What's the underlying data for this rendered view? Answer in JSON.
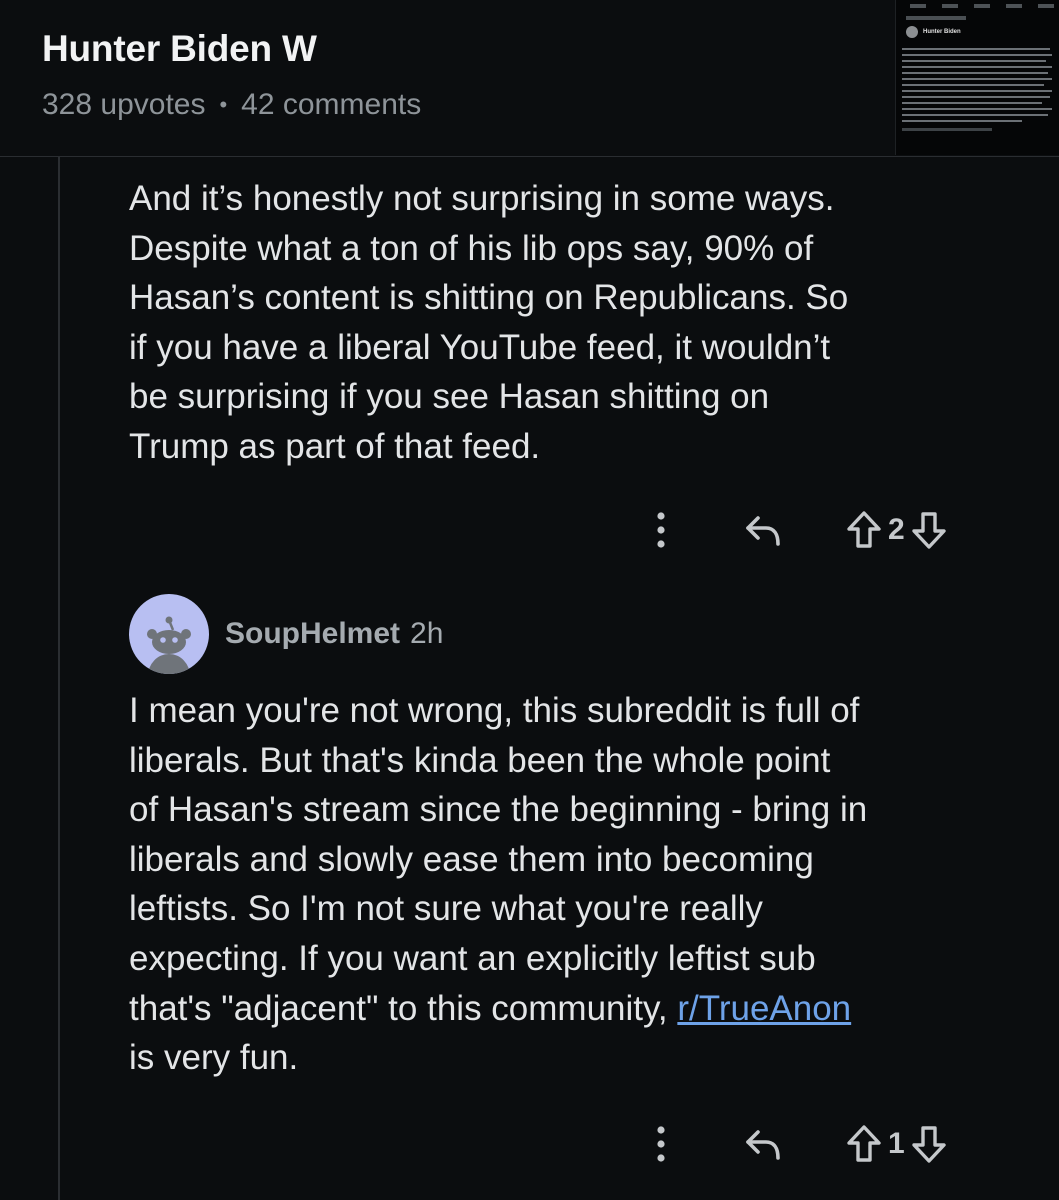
{
  "post": {
    "title": "Hunter Biden W",
    "upvotes": "328 upvotes",
    "separator": "•",
    "comments": "42 comments",
    "thumbnail": {
      "author": "Hunter Biden"
    }
  },
  "comments": [
    {
      "lines": [
        "And it’s honestly not surprising in some ways.",
        "Despite what a ton of his lib ops say, 90% of",
        "Hasan’s content is shitting on Republicans. So",
        "if you have a liberal YouTube feed, it wouldn’t",
        "be surprising if you see Hasan shitting on",
        "Trump as part of that feed."
      ],
      "score": "2"
    },
    {
      "author": "SoupHelmet",
      "time": "2h",
      "lines": [
        "I mean you're not wrong, this subreddit is full of",
        "liberals. But that's kinda been the whole point",
        "of Hasan's stream since the beginning - bring in",
        "liberals and slowly ease them into becoming",
        "leftists. So I'm not sure what you're really",
        "expecting. If you want an explicitly leftist sub"
      ],
      "line7_before": "that's \"adjacent\" to this community, ",
      "link": "r/TrueAnon",
      "line8": "is very fun.",
      "score": "1"
    }
  ],
  "icons": {
    "more": "more-vertical-icon",
    "reply": "reply-icon",
    "upvote": "upvote-arrow-icon",
    "downvote": "downvote-arrow-icon",
    "avatar": "snoo-avatar"
  },
  "colors": {
    "background": "#0b0d0f",
    "text": "#e3e5e7",
    "meta": "#8e9499",
    "link": "#6ea2e8",
    "avatar_bg": "#b8bff2"
  }
}
